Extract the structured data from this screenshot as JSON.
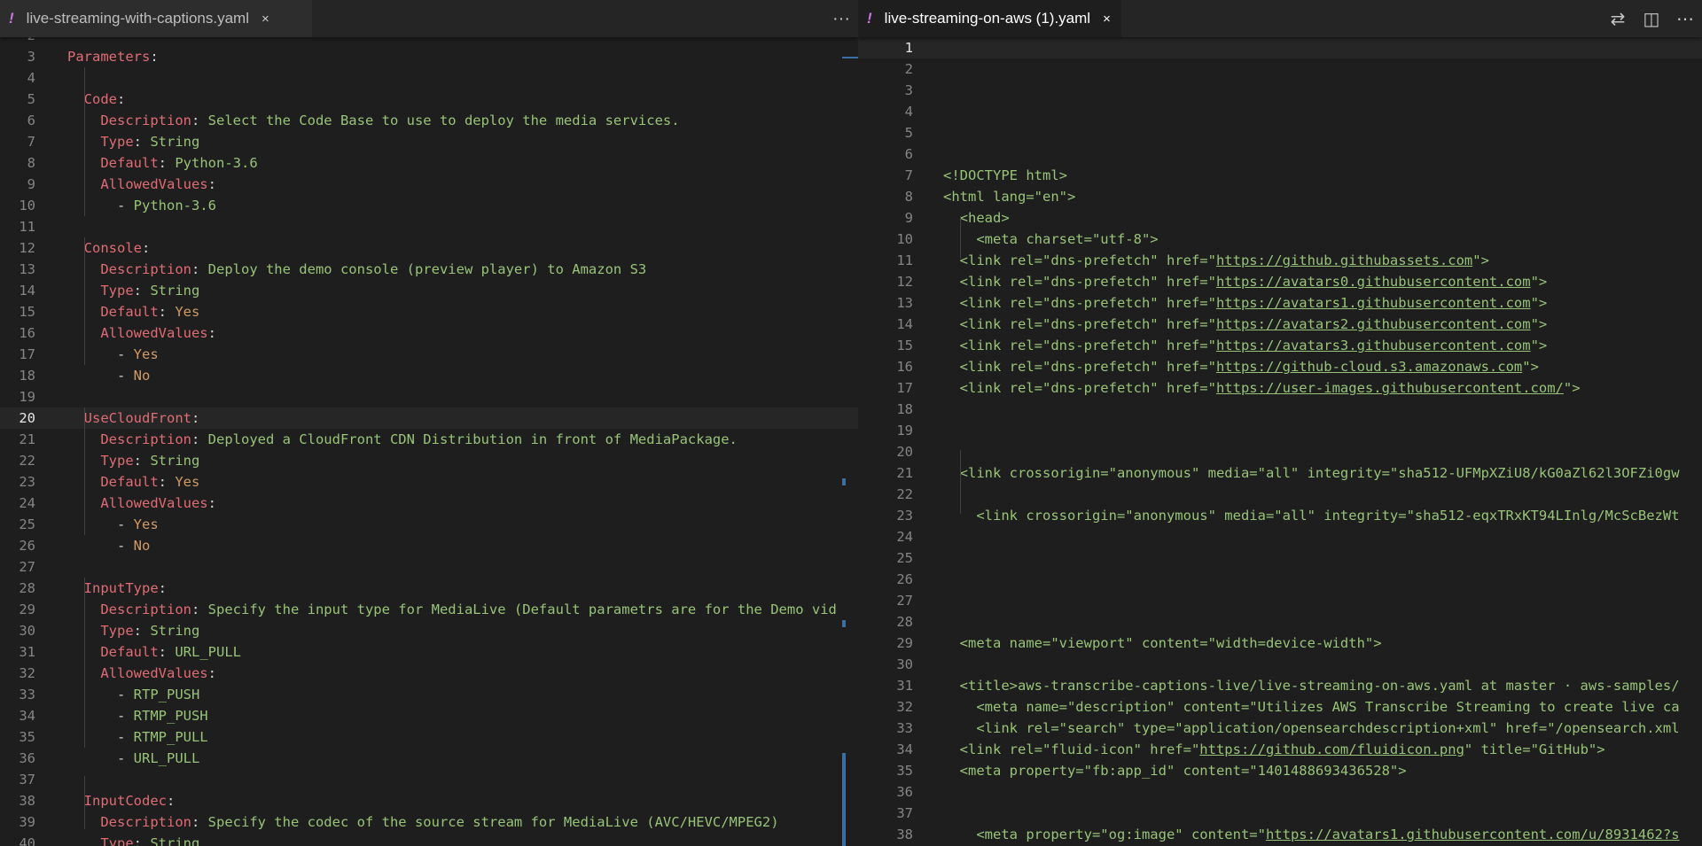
{
  "left": {
    "tab": {
      "icon": "!",
      "label": "live-streaming-with-captions.yaml",
      "close": "×"
    },
    "more_actions": "···",
    "first_partial_number": "2",
    "lines": [
      {
        "n": "3",
        "tokens": [
          {
            "t": "k",
            "v": "Parameters"
          },
          {
            "t": "p",
            "v": ":"
          }
        ]
      },
      {
        "n": "4",
        "tokens": []
      },
      {
        "n": "5",
        "tokens": [
          {
            "t": "p",
            "v": "  "
          },
          {
            "t": "k",
            "v": "Code"
          },
          {
            "t": "p",
            "v": ":"
          }
        ]
      },
      {
        "n": "6",
        "tokens": [
          {
            "t": "p",
            "v": "    "
          },
          {
            "t": "k",
            "v": "Description"
          },
          {
            "t": "p",
            "v": ": "
          },
          {
            "t": "s",
            "v": "Select the Code Base to use to deploy the media services."
          }
        ]
      },
      {
        "n": "7",
        "tokens": [
          {
            "t": "p",
            "v": "    "
          },
          {
            "t": "k",
            "v": "Type"
          },
          {
            "t": "p",
            "v": ": "
          },
          {
            "t": "s",
            "v": "String"
          }
        ]
      },
      {
        "n": "8",
        "tokens": [
          {
            "t": "p",
            "v": "    "
          },
          {
            "t": "k",
            "v": "Default"
          },
          {
            "t": "p",
            "v": ": "
          },
          {
            "t": "s",
            "v": "Python-3.6"
          }
        ]
      },
      {
        "n": "9",
        "tokens": [
          {
            "t": "p",
            "v": "    "
          },
          {
            "t": "k",
            "v": "AllowedValues"
          },
          {
            "t": "p",
            "v": ":"
          }
        ]
      },
      {
        "n": "10",
        "tokens": [
          {
            "t": "p",
            "v": "      - "
          },
          {
            "t": "s",
            "v": "Python-3.6"
          }
        ]
      },
      {
        "n": "11",
        "tokens": []
      },
      {
        "n": "12",
        "tokens": [
          {
            "t": "p",
            "v": "  "
          },
          {
            "t": "k",
            "v": "Console"
          },
          {
            "t": "p",
            "v": ":"
          }
        ]
      },
      {
        "n": "13",
        "tokens": [
          {
            "t": "p",
            "v": "    "
          },
          {
            "t": "k",
            "v": "Description"
          },
          {
            "t": "p",
            "v": ": "
          },
          {
            "t": "s",
            "v": "Deploy the demo console (preview player) to Amazon S3"
          }
        ]
      },
      {
        "n": "14",
        "tokens": [
          {
            "t": "p",
            "v": "    "
          },
          {
            "t": "k",
            "v": "Type"
          },
          {
            "t": "p",
            "v": ": "
          },
          {
            "t": "s",
            "v": "String"
          }
        ]
      },
      {
        "n": "15",
        "tokens": [
          {
            "t": "p",
            "v": "    "
          },
          {
            "t": "k",
            "v": "Default"
          },
          {
            "t": "p",
            "v": ": "
          },
          {
            "t": "y",
            "v": "Yes"
          }
        ]
      },
      {
        "n": "16",
        "tokens": [
          {
            "t": "p",
            "v": "    "
          },
          {
            "t": "k",
            "v": "AllowedValues"
          },
          {
            "t": "p",
            "v": ":"
          }
        ]
      },
      {
        "n": "17",
        "tokens": [
          {
            "t": "p",
            "v": "      - "
          },
          {
            "t": "y",
            "v": "Yes"
          }
        ]
      },
      {
        "n": "18",
        "tokens": [
          {
            "t": "p",
            "v": "      - "
          },
          {
            "t": "y",
            "v": "No"
          }
        ]
      },
      {
        "n": "19",
        "tokens": []
      },
      {
        "n": "20",
        "current": true,
        "tokens": [
          {
            "t": "p",
            "v": "  "
          },
          {
            "t": "k",
            "v": "UseCloudFront"
          },
          {
            "t": "p",
            "v": ":"
          }
        ]
      },
      {
        "n": "21",
        "tokens": [
          {
            "t": "p",
            "v": "    "
          },
          {
            "t": "k",
            "v": "Description"
          },
          {
            "t": "p",
            "v": ": "
          },
          {
            "t": "s",
            "v": "Deployed a CloudFront CDN Distribution in front of MediaPackage."
          }
        ]
      },
      {
        "n": "22",
        "tokens": [
          {
            "t": "p",
            "v": "    "
          },
          {
            "t": "k",
            "v": "Type"
          },
          {
            "t": "p",
            "v": ": "
          },
          {
            "t": "s",
            "v": "String"
          }
        ]
      },
      {
        "n": "23",
        "tokens": [
          {
            "t": "p",
            "v": "    "
          },
          {
            "t": "k",
            "v": "Default"
          },
          {
            "t": "p",
            "v": ": "
          },
          {
            "t": "y",
            "v": "Yes"
          }
        ]
      },
      {
        "n": "24",
        "tokens": [
          {
            "t": "p",
            "v": "    "
          },
          {
            "t": "k",
            "v": "AllowedValues"
          },
          {
            "t": "p",
            "v": ":"
          }
        ]
      },
      {
        "n": "25",
        "tokens": [
          {
            "t": "p",
            "v": "      - "
          },
          {
            "t": "y",
            "v": "Yes"
          }
        ]
      },
      {
        "n": "26",
        "tokens": [
          {
            "t": "p",
            "v": "      - "
          },
          {
            "t": "y",
            "v": "No"
          }
        ]
      },
      {
        "n": "27",
        "tokens": []
      },
      {
        "n": "28",
        "tokens": [
          {
            "t": "p",
            "v": "  "
          },
          {
            "t": "k",
            "v": "InputType"
          },
          {
            "t": "p",
            "v": ":"
          }
        ]
      },
      {
        "n": "29",
        "tokens": [
          {
            "t": "p",
            "v": "    "
          },
          {
            "t": "k",
            "v": "Description"
          },
          {
            "t": "p",
            "v": ": "
          },
          {
            "t": "s",
            "v": "Specify the input type for MediaLive (Default parametrs are for the Demo vid"
          }
        ]
      },
      {
        "n": "30",
        "tokens": [
          {
            "t": "p",
            "v": "    "
          },
          {
            "t": "k",
            "v": "Type"
          },
          {
            "t": "p",
            "v": ": "
          },
          {
            "t": "s",
            "v": "String"
          }
        ]
      },
      {
        "n": "31",
        "tokens": [
          {
            "t": "p",
            "v": "    "
          },
          {
            "t": "k",
            "v": "Default"
          },
          {
            "t": "p",
            "v": ": "
          },
          {
            "t": "s",
            "v": "URL_PULL"
          }
        ]
      },
      {
        "n": "32",
        "tokens": [
          {
            "t": "p",
            "v": "    "
          },
          {
            "t": "k",
            "v": "AllowedValues"
          },
          {
            "t": "p",
            "v": ":"
          }
        ]
      },
      {
        "n": "33",
        "tokens": [
          {
            "t": "p",
            "v": "      - "
          },
          {
            "t": "s",
            "v": "RTP_PUSH"
          }
        ]
      },
      {
        "n": "34",
        "tokens": [
          {
            "t": "p",
            "v": "      - "
          },
          {
            "t": "s",
            "v": "RTMP_PUSH"
          }
        ]
      },
      {
        "n": "35",
        "tokens": [
          {
            "t": "p",
            "v": "      - "
          },
          {
            "t": "s",
            "v": "RTMP_PULL"
          }
        ]
      },
      {
        "n": "36",
        "tokens": [
          {
            "t": "p",
            "v": "      - "
          },
          {
            "t": "s",
            "v": "URL_PULL"
          }
        ]
      },
      {
        "n": "37",
        "tokens": []
      },
      {
        "n": "38",
        "tokens": [
          {
            "t": "p",
            "v": "  "
          },
          {
            "t": "k",
            "v": "InputCodec"
          },
          {
            "t": "p",
            "v": ":"
          }
        ]
      },
      {
        "n": "39",
        "tokens": [
          {
            "t": "p",
            "v": "    "
          },
          {
            "t": "k",
            "v": "Description"
          },
          {
            "t": "p",
            "v": ": "
          },
          {
            "t": "s",
            "v": "Specify the codec of the source stream for MediaLive (AVC/HEVC/MPEG2)"
          }
        ]
      },
      {
        "n": "40",
        "tokens": [
          {
            "t": "p",
            "v": "    "
          },
          {
            "t": "k",
            "v": "Type"
          },
          {
            "t": "p",
            "v": ": "
          },
          {
            "t": "s",
            "v": "String"
          }
        ]
      }
    ]
  },
  "right": {
    "tab": {
      "icon": "!",
      "label": "live-streaming-on-aws (1).yaml",
      "close": "×"
    },
    "actions": {
      "compare": "⇄",
      "split": "◫",
      "more": "⋯"
    },
    "lines": [
      {
        "n": "1",
        "current": true,
        "tokens": []
      },
      {
        "n": "2",
        "tokens": []
      },
      {
        "n": "3",
        "tokens": []
      },
      {
        "n": "4",
        "tokens": []
      },
      {
        "n": "5",
        "tokens": []
      },
      {
        "n": "6",
        "tokens": []
      },
      {
        "n": "7",
        "tokens": [
          {
            "t": "s",
            "v": "<!DOCTYPE html>"
          }
        ]
      },
      {
        "n": "8",
        "tokens": [
          {
            "t": "s",
            "v": "<html lang=\"en\">"
          }
        ]
      },
      {
        "n": "9",
        "tokens": [
          {
            "t": "s",
            "v": "  <head>"
          }
        ]
      },
      {
        "n": "10",
        "tokens": [
          {
            "t": "s",
            "v": "    <meta charset=\"utf-8\">"
          }
        ]
      },
      {
        "n": "11",
        "tokens": [
          {
            "t": "s",
            "v": "  <link rel=\"dns-prefetch\" href=\""
          },
          {
            "t": "lnk",
            "v": "https://github.githubassets.com"
          },
          {
            "t": "s",
            "v": "\">"
          }
        ]
      },
      {
        "n": "12",
        "tokens": [
          {
            "t": "s",
            "v": "  <link rel=\"dns-prefetch\" href=\""
          },
          {
            "t": "lnk",
            "v": "https://avatars0.githubusercontent.com"
          },
          {
            "t": "s",
            "v": "\">"
          }
        ]
      },
      {
        "n": "13",
        "tokens": [
          {
            "t": "s",
            "v": "  <link rel=\"dns-prefetch\" href=\""
          },
          {
            "t": "lnk",
            "v": "https://avatars1.githubusercontent.com"
          },
          {
            "t": "s",
            "v": "\">"
          }
        ]
      },
      {
        "n": "14",
        "tokens": [
          {
            "t": "s",
            "v": "  <link rel=\"dns-prefetch\" href=\""
          },
          {
            "t": "lnk",
            "v": "https://avatars2.githubusercontent.com"
          },
          {
            "t": "s",
            "v": "\">"
          }
        ]
      },
      {
        "n": "15",
        "tokens": [
          {
            "t": "s",
            "v": "  <link rel=\"dns-prefetch\" href=\""
          },
          {
            "t": "lnk",
            "v": "https://avatars3.githubusercontent.com"
          },
          {
            "t": "s",
            "v": "\">"
          }
        ]
      },
      {
        "n": "16",
        "tokens": [
          {
            "t": "s",
            "v": "  <link rel=\"dns-prefetch\" href=\""
          },
          {
            "t": "lnk",
            "v": "https://github-cloud.s3.amazonaws.com"
          },
          {
            "t": "s",
            "v": "\">"
          }
        ]
      },
      {
        "n": "17",
        "tokens": [
          {
            "t": "s",
            "v": "  <link rel=\"dns-prefetch\" href=\""
          },
          {
            "t": "lnk",
            "v": "https://user-images.githubusercontent.com/"
          },
          {
            "t": "s",
            "v": "\">"
          }
        ]
      },
      {
        "n": "18",
        "tokens": []
      },
      {
        "n": "19",
        "tokens": []
      },
      {
        "n": "20",
        "tokens": []
      },
      {
        "n": "21",
        "tokens": [
          {
            "t": "s",
            "v": "  <link crossorigin=\"anonymous\" media=\"all\" integrity=\"sha512-UFMpXZiU8/kG0aZl62l3OFZi0gw"
          }
        ]
      },
      {
        "n": "22",
        "tokens": []
      },
      {
        "n": "23",
        "tokens": [
          {
            "t": "s",
            "v": "    <link crossorigin=\"anonymous\" media=\"all\" integrity=\"sha512-eqxTRxKT94LInlg/McScBezWt"
          }
        ]
      },
      {
        "n": "24",
        "tokens": []
      },
      {
        "n": "25",
        "tokens": []
      },
      {
        "n": "26",
        "tokens": []
      },
      {
        "n": "27",
        "tokens": []
      },
      {
        "n": "28",
        "tokens": []
      },
      {
        "n": "29",
        "tokens": [
          {
            "t": "s",
            "v": "  <meta name=\"viewport\" content=\"width=device-width\">"
          }
        ]
      },
      {
        "n": "30",
        "tokens": []
      },
      {
        "n": "31",
        "tokens": [
          {
            "t": "s",
            "v": "  <title>aws-transcribe-captions-live/live-streaming-on-aws.yaml at master · aws-samples/"
          }
        ]
      },
      {
        "n": "32",
        "tokens": [
          {
            "t": "s",
            "v": "    <meta name=\"description\" content=\"Utilizes AWS Transcribe Streaming to create live ca"
          }
        ]
      },
      {
        "n": "33",
        "tokens": [
          {
            "t": "s",
            "v": "    <link rel=\"search\" type=\"application/opensearchdescription+xml\" href=\"/opensearch.xml"
          }
        ]
      },
      {
        "n": "34",
        "tokens": [
          {
            "t": "s",
            "v": "  <link rel=\"fluid-icon\" href=\""
          },
          {
            "t": "lnk",
            "v": "https://github.com/fluidicon.png"
          },
          {
            "t": "s",
            "v": "\" title=\"GitHub\">"
          }
        ]
      },
      {
        "n": "35",
        "tokens": [
          {
            "t": "s",
            "v": "  <meta property=\"fb:app_id\" content=\"1401488693436528\">"
          }
        ]
      },
      {
        "n": "36",
        "tokens": []
      },
      {
        "n": "37",
        "tokens": []
      },
      {
        "n": "38",
        "tokens": [
          {
            "t": "s",
            "v": "    <meta property=\"og:image\" content=\""
          },
          {
            "t": "lnk",
            "v": "https://avatars1.githubusercontent.com/u/8931462?s"
          }
        ]
      }
    ]
  }
}
